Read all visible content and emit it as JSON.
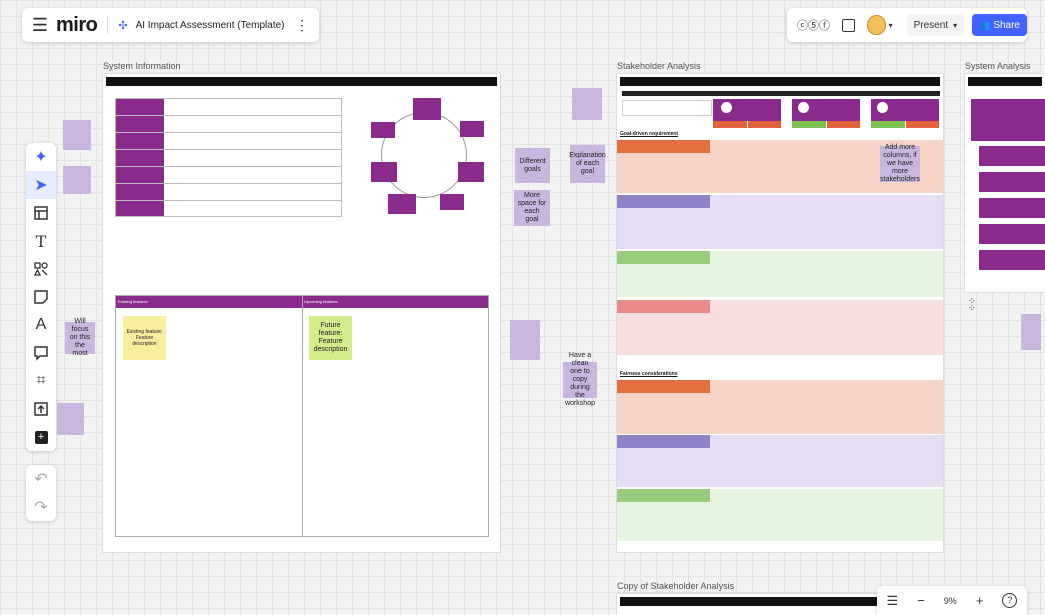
{
  "topbar": {
    "logo": "miro",
    "board_title": "AI Impact Assessment (Template)",
    "present_label": "Present",
    "share_label": "Share",
    "reaction_text": "ⓒ⑤ⓕ"
  },
  "frames": {
    "system_information": {
      "title": "System Information",
      "existing_features_header": "Existing features",
      "upcoming_features_header": "Upcoming features",
      "existing_feature_sticky": "Existing feature: Feature description",
      "future_feature_sticky": "Future feature: Feature description"
    },
    "stakeholder_analysis": {
      "title": "Stakeholder Analysis",
      "goal_driven_label": "Goal-driven requirement",
      "fairness_label": "Fairness considerations"
    },
    "system_analysis": {
      "title": "System Analysis"
    },
    "copy_stakeholder": {
      "title": "Copy of Stakeholder Analysis"
    }
  },
  "stickies": {
    "different_goals": "Different goals",
    "explanation_goal": "Explanation of each goal",
    "more_space": "More space for each goal",
    "will_focus": "Will focus on this the most",
    "have_clean_one": "Have a clean one to copy during the workshop",
    "add_more_columns": "Add more columns, if we have more stakeholders"
  },
  "zoom": {
    "level": "9%"
  },
  "colors": {
    "accent": "#4262ff",
    "purple": "#8a2a8c",
    "sticky_purple": "#c9b6df",
    "sticky_yellow": "#f7ef9e",
    "sticky_lime": "#d4ec8a"
  }
}
